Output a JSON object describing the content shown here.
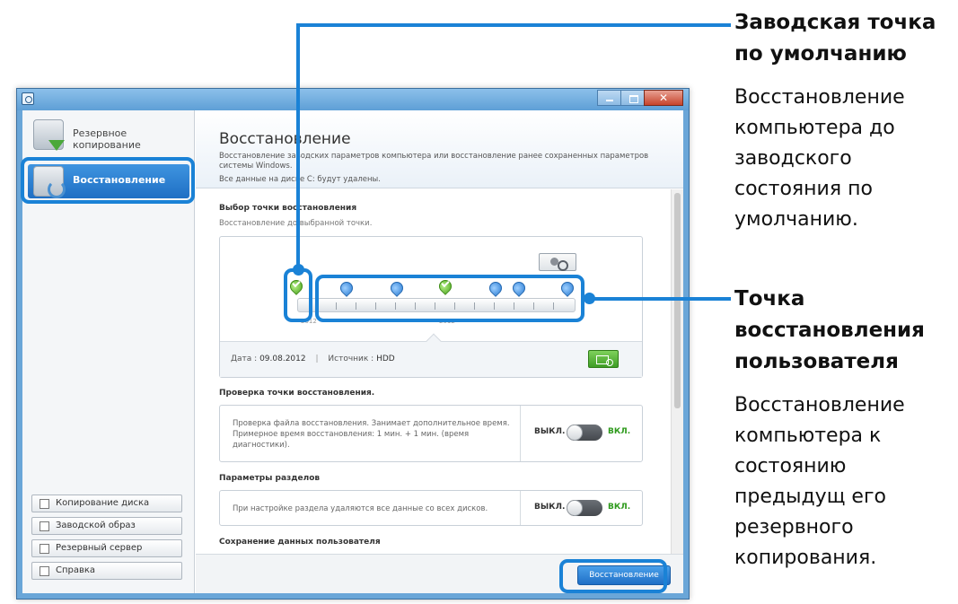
{
  "sidebar": {
    "items": [
      {
        "label": "Резервное копирование",
        "icon": "backup-icon"
      },
      {
        "label": "Восстановление",
        "icon": "restore-icon"
      }
    ],
    "bottom_buttons": [
      {
        "label": "Копирование диска",
        "icon": "disk-copy-icon"
      },
      {
        "label": "Заводской образ",
        "icon": "factory-image-icon"
      },
      {
        "label": "Резервный сервер",
        "icon": "backup-server-icon"
      },
      {
        "label": "Справка",
        "icon": "help-icon"
      }
    ]
  },
  "main": {
    "title": "Восстановление",
    "description": "Восстановление заводских параметров компьютера или восстановление ранее сохраненных параметров системы Windows.",
    "warning": "Все данные на диске C: будут удалены.",
    "select_point": {
      "title": "Выбор точки восстановления",
      "subtitle": "Восстановление до выбранной точки.",
      "years": [
        "2012",
        "2012"
      ],
      "date_label": "Дата :",
      "date_value": "09.08.2012",
      "source_label": "Источник :",
      "source_value": "HDD"
    },
    "verify": {
      "title": "Проверка точки восстановления.",
      "text": "Проверка файла восстановления. Занимает дополнительное время. Примерное время восстановления: 1 мин. + 1 мин. (время диагностики).",
      "off_label": "ВЫКЛ.",
      "on_label": "ВКЛ."
    },
    "partitions": {
      "title": "Параметры разделов",
      "text": "При настройке раздела удаляются все данные со всех дисков.",
      "off_label": "ВЫКЛ.",
      "on_label": "ВКЛ."
    },
    "user_data": {
      "title": "Сохранение данных пользователя"
    },
    "restore_button": "Восстановление"
  },
  "annotations": {
    "factory": {
      "title": "Заводская точка по умолчанию",
      "body": "Восстановление компьютера до заводского состояния по умолчанию."
    },
    "user": {
      "title": "Точка восстановления пользователя",
      "body": "Восстановление компьютера к состоянию предыдущ его резервного копирования."
    }
  },
  "colors": {
    "accent": "#1a82d6",
    "active_item": "#1e6fc4",
    "on_green": "#2e9a1c"
  }
}
